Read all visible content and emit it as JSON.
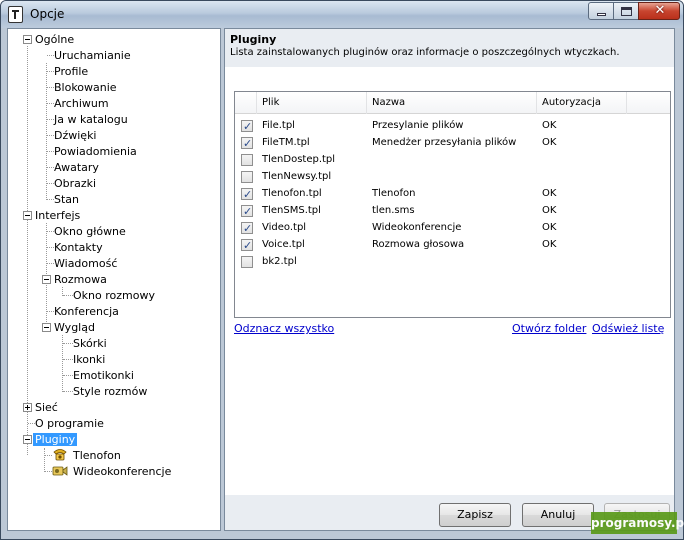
{
  "window": {
    "title": "Opcje",
    "minimize_glyph": "",
    "close_glyph": "✕"
  },
  "tree": {
    "items": [
      {
        "label": "Ogólne"
      },
      {
        "label": "Uruchamianie"
      },
      {
        "label": "Profile"
      },
      {
        "label": "Blokowanie"
      },
      {
        "label": "Archiwum"
      },
      {
        "label": "Ja w katalogu"
      },
      {
        "label": "Dźwięki"
      },
      {
        "label": "Powiadomienia"
      },
      {
        "label": "Awatary"
      },
      {
        "label": "Obrazki"
      },
      {
        "label": "Stan"
      },
      {
        "label": "Interfejs"
      },
      {
        "label": "Okno główne"
      },
      {
        "label": "Kontakty"
      },
      {
        "label": "Wiadomość"
      },
      {
        "label": "Rozmowa"
      },
      {
        "label": "Okno rozmowy"
      },
      {
        "label": "Konferencja"
      },
      {
        "label": "Wygląd"
      },
      {
        "label": "Skórki"
      },
      {
        "label": "Ikonki"
      },
      {
        "label": "Emotikonki"
      },
      {
        "label": "Style rozmów"
      },
      {
        "label": "Sieć"
      },
      {
        "label": "O programie"
      },
      {
        "label": "Pluginy"
      },
      {
        "label": "Tlenofon"
      },
      {
        "label": "Wideokonferencje"
      }
    ],
    "selected": "Pluginy"
  },
  "panel": {
    "title": "Pluginy",
    "description": "Lista zainstalowanych pluginów oraz informacje o poszczególnych wtyczkach."
  },
  "list": {
    "columns": [
      "Plik",
      "Nazwa",
      "Autoryzacja"
    ],
    "rows": [
      {
        "checked": true,
        "file": "File.tpl",
        "name": "Przesylanie plików",
        "auth": "OK"
      },
      {
        "checked": true,
        "file": "FileTM.tpl",
        "name": "Menedżer przesyłania plików",
        "auth": "OK"
      },
      {
        "checked": false,
        "file": "TlenDostep.tpl",
        "name": "",
        "auth": ""
      },
      {
        "checked": false,
        "file": "TlenNewsy.tpl",
        "name": "",
        "auth": ""
      },
      {
        "checked": true,
        "file": "Tlenofon.tpl",
        "name": "Tlenofon",
        "auth": "OK"
      },
      {
        "checked": true,
        "file": "TlenSMS.tpl",
        "name": "tlen.sms",
        "auth": "OK"
      },
      {
        "checked": true,
        "file": "Video.tpl",
        "name": "Wideokonferencje",
        "auth": "OK"
      },
      {
        "checked": true,
        "file": "Voice.tpl",
        "name": "Rozmowa głosowa",
        "auth": "OK"
      },
      {
        "checked": false,
        "file": "bk2.tpl",
        "name": "",
        "auth": ""
      }
    ]
  },
  "links": {
    "uncheck_all": "Odznacz wszystko",
    "open_folder": "Otwórz folder",
    "refresh_list": "Odśwież listę"
  },
  "buttons": {
    "save": "Zapisz",
    "cancel": "Anuluj",
    "apply": "Zastosuj"
  },
  "watermark": "programosy.pl"
}
